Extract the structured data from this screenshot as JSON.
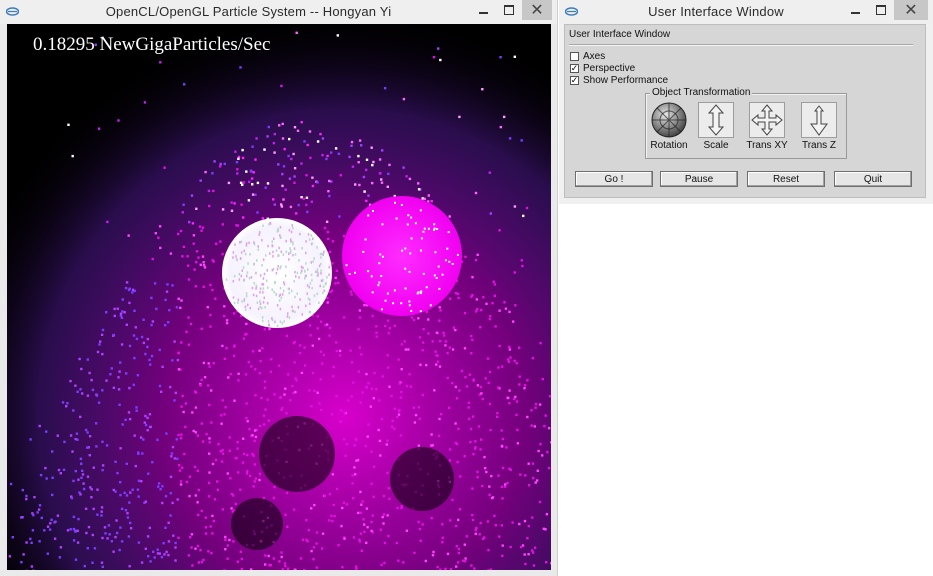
{
  "left_window": {
    "title": "OpenCL/OpenGL Particle System -- Hongyan Yi",
    "performance_text": "0.18295 NewGigaParticles/Sec"
  },
  "right_window": {
    "title": "User Interface Window",
    "panel_title": "User Interface Window",
    "checkboxes": [
      {
        "label": "Axes",
        "checked": false
      },
      {
        "label": "Perspective",
        "checked": true
      },
      {
        "label": "Show Performance",
        "checked": true
      }
    ],
    "transform_group": {
      "label": "Object Transformation",
      "tools": [
        {
          "label": "Rotation",
          "icon": "rotation-sphere-icon"
        },
        {
          "label": "Scale",
          "icon": "scale-arrow-icon"
        },
        {
          "label": "Trans XY",
          "icon": "move-xy-icon"
        },
        {
          "label": "Trans Z",
          "icon": "move-z-icon"
        }
      ]
    },
    "buttons": {
      "go": "Go !",
      "pause": "Pause",
      "reset": "Reset",
      "quit": "Quit"
    }
  },
  "window_controls": {
    "minimize": "minimize-icon",
    "maximize": "maximize-icon",
    "close": "close-icon",
    "close_glyph": "✕"
  },
  "colors": {
    "white_sphere": "#ffffff",
    "magenta_sphere": "#ff1aff",
    "particle_magenta": "#e010e0",
    "particle_violet": "#7a3cff",
    "canvas_bg": "#000000"
  }
}
